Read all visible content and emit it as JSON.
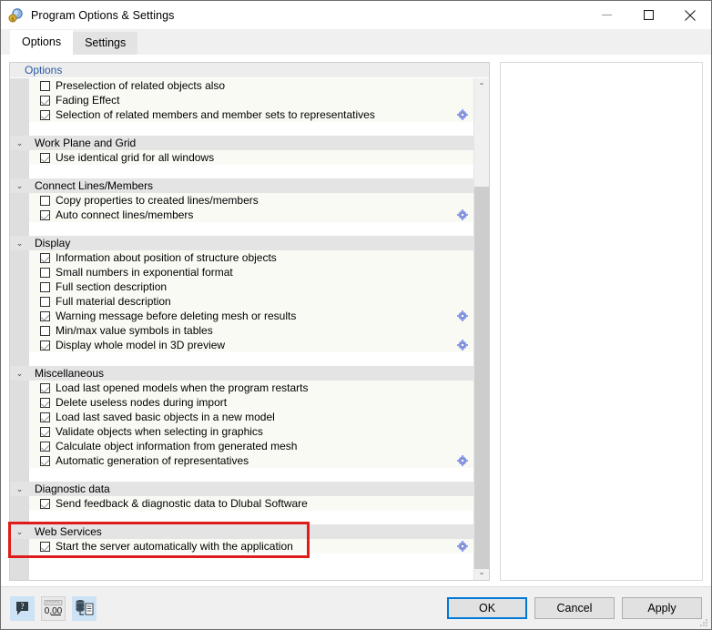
{
  "window": {
    "title": "Program Options & Settings",
    "icon": "app-settings-icon",
    "minimize_label": "—",
    "maximize_label": "☐",
    "close_label": "✕"
  },
  "tabs": [
    {
      "label": "Options",
      "active": true
    },
    {
      "label": "Settings",
      "active": false
    }
  ],
  "panel": {
    "header": "Options",
    "accent_color": "#2a5aa0",
    "highlight_color": "#e01b1b"
  },
  "scrollbar": {
    "up_arrow": "⌃",
    "down_arrow": "⌄"
  },
  "groups": [
    {
      "name": "",
      "show_header": false,
      "highlighted": false,
      "items": [
        {
          "label": "Preselection of related objects also",
          "checked": false,
          "gear": false
        },
        {
          "label": "Fading Effect",
          "checked": true,
          "gear": false
        },
        {
          "label": "Selection of related members and member sets to representatives",
          "checked": true,
          "gear": true
        }
      ]
    },
    {
      "name": "Work Plane and Grid",
      "show_header": true,
      "highlighted": false,
      "items": [
        {
          "label": "Use identical grid for all windows",
          "checked": true,
          "gear": false
        }
      ]
    },
    {
      "name": "Connect Lines/Members",
      "show_header": true,
      "highlighted": false,
      "items": [
        {
          "label": "Copy properties to created lines/members",
          "checked": false,
          "gear": false
        },
        {
          "label": "Auto connect lines/members",
          "checked": true,
          "gear": true
        }
      ]
    },
    {
      "name": "Display",
      "show_header": true,
      "highlighted": false,
      "items": [
        {
          "label": "Information about position of structure objects",
          "checked": true,
          "gear": false
        },
        {
          "label": "Small numbers in exponential format",
          "checked": false,
          "gear": false
        },
        {
          "label": "Full section description",
          "checked": false,
          "gear": false
        },
        {
          "label": "Full material description",
          "checked": false,
          "gear": false
        },
        {
          "label": "Warning message before deleting mesh or results",
          "checked": true,
          "gear": true
        },
        {
          "label": "Min/max value symbols in tables",
          "checked": false,
          "gear": false
        },
        {
          "label": "Display whole model in 3D preview",
          "checked": true,
          "gear": true
        }
      ]
    },
    {
      "name": "Miscellaneous",
      "show_header": true,
      "highlighted": false,
      "items": [
        {
          "label": "Load last opened models when the program restarts",
          "checked": true,
          "gear": false
        },
        {
          "label": "Delete useless nodes during import",
          "checked": true,
          "gear": false
        },
        {
          "label": "Load last saved basic objects in a new model",
          "checked": true,
          "gear": false
        },
        {
          "label": "Validate objects when selecting in graphics",
          "checked": true,
          "gear": false
        },
        {
          "label": "Calculate object information from generated mesh",
          "checked": true,
          "gear": false
        },
        {
          "label": "Automatic generation of representatives",
          "checked": true,
          "gear": true
        }
      ]
    },
    {
      "name": "Diagnostic data",
      "show_header": true,
      "highlighted": false,
      "items": [
        {
          "label": "Send feedback & diagnostic data to Dlubal Software",
          "checked": true,
          "gear": false
        }
      ]
    },
    {
      "name": "Web Services",
      "show_header": true,
      "highlighted": true,
      "items": [
        {
          "label": "Start the server automatically with the application",
          "checked": true,
          "gear": true
        }
      ]
    }
  ],
  "footer": {
    "tools": [
      {
        "name": "help-icon",
        "label": ""
      },
      {
        "name": "decimal-places-icon",
        "label": "0,00"
      },
      {
        "name": "export-data-icon",
        "label": ""
      }
    ],
    "buttons": [
      {
        "label": "OK",
        "default": true
      },
      {
        "label": "Cancel",
        "default": false
      },
      {
        "label": "Apply",
        "default": false
      }
    ]
  }
}
